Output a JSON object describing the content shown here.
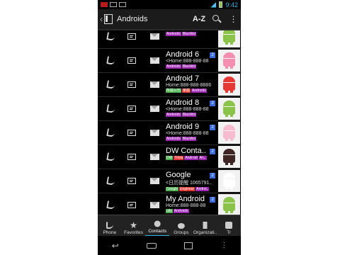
{
  "statusbar": {
    "time": "9:42"
  },
  "actionbar": {
    "title": "Androids",
    "sort_label": "A-Z",
    "search_icon": "search-icon",
    "overflow": "⋮"
  },
  "colors": {
    "accent": "#33b5e5",
    "badge": "#3b6cd9",
    "tag_purple": "#9c27b0",
    "tag_green": "#4caf50",
    "tag_red": "#e53935",
    "tag_orange": "#ef6c00",
    "droid_green": "#8bc34a"
  },
  "contacts": [
    {
      "name": "",
      "sub": "<Home:888-888-88",
      "tags": [
        {
          "text": "Androids",
          "color": "#9c27b0"
        },
        {
          "text": "Blacklist",
          "color": "#9c27b0"
        }
      ],
      "badge": "",
      "thumb": "#8bc34a"
    },
    {
      "name": "Android 6",
      "sub": "<Home:888-888-88",
      "tags": [
        {
          "text": "Androids",
          "color": "#9c27b0"
        },
        {
          "text": "Blacklist",
          "color": "#9c27b0"
        }
      ],
      "badge": "2",
      "thumb": "#f48fb1"
    },
    {
      "name": "Android 7",
      "sub": "Home:888-888-8886",
      "tags": [
        {
          "text": "所属公司",
          "color": "#4caf50"
        },
        {
          "text": "家庭",
          "color": "#e53935"
        },
        {
          "text": "Androids",
          "color": "#9c27b0"
        }
      ],
      "badge": "",
      "thumb": "#e53935"
    },
    {
      "name": "Android 8",
      "sub": "<Home:888-888-88",
      "tags": [
        {
          "text": "Androids",
          "color": "#9c27b0"
        },
        {
          "text": "Blacklist",
          "color": "#9c27b0"
        }
      ],
      "badge": "2",
      "thumb": "#8bc34a"
    },
    {
      "name": "Android 9",
      "sub": "<Home:888-888-88",
      "tags": [
        {
          "text": "Androids",
          "color": "#9c27b0"
        },
        {
          "text": "Blacklist",
          "color": "#9c27b0"
        }
      ],
      "badge": "2",
      "thumb": "#f8bbd0"
    },
    {
      "name": "DW Conta..",
      "sub": "",
      "tags": [
        {
          "text": "DW",
          "color": "#4caf50"
        },
        {
          "text": "Trivia",
          "color": "#e53935"
        },
        {
          "text": "Android",
          "color": "#9c27b0"
        },
        {
          "text": "An..",
          "color": "#9c27b0"
        }
      ],
      "badge": "2",
      "thumb": "#3e2723"
    },
    {
      "name": "Google",
      "sub": "<日历提醒 1065791..",
      "tags": [
        {
          "text": "Google",
          "color": "#4caf50"
        },
        {
          "text": "Engineer",
          "color": "#e53935"
        },
        {
          "text": "Androi..",
          "color": "#9c27b0"
        }
      ],
      "badge": "2",
      "thumb": "#ffffff"
    },
    {
      "name": "My Android",
      "sub": "Home:888-888-88",
      "tags": [
        {
          "text": "ulla",
          "color": "#4caf50"
        },
        {
          "text": "Androids",
          "color": "#9c27b0"
        }
      ],
      "badge": "2",
      "thumb": "#8bc34a"
    }
  ],
  "tabs": [
    {
      "label": "Phone",
      "icon": "phone-icon"
    },
    {
      "label": "Favorites",
      "icon": "star-icon"
    },
    {
      "label": "Contacts",
      "icon": "person-icon",
      "selected": true
    },
    {
      "label": "Groups",
      "icon": "group-icon"
    },
    {
      "label": "Organizati..",
      "icon": "org-icon"
    },
    {
      "label": "Tr",
      "icon": "more-icon"
    }
  ],
  "navbar": {
    "back": "back-icon",
    "home": "home-icon",
    "recent": "recents-icon",
    "menu": "menu-icon"
  }
}
